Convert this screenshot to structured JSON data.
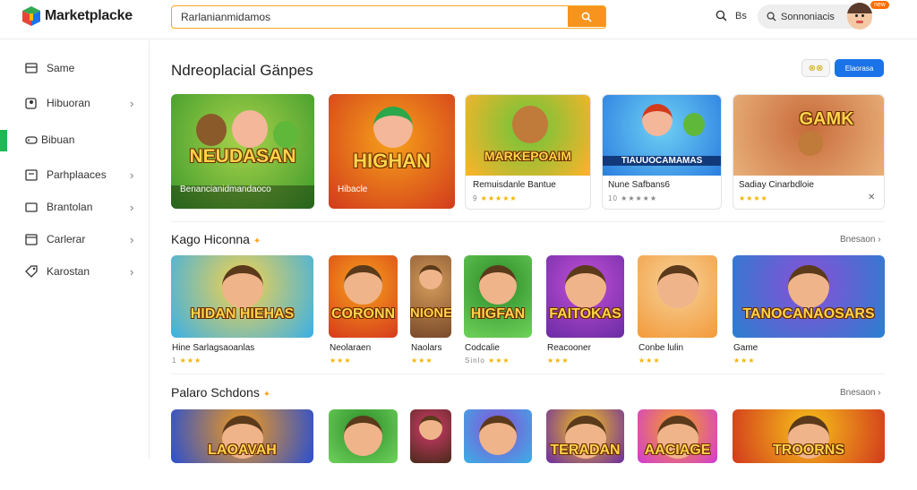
{
  "header": {
    "logo_text": "Marketplacke",
    "search_value": "Rarlanianmidamos",
    "secondary_label": "Bs",
    "user_chip_label": "Sonnoniacis",
    "badge": "new"
  },
  "sidebar": {
    "items": [
      {
        "label": "Same",
        "icon": "window-icon",
        "chevron": false,
        "active": false
      },
      {
        "label": "Hibuoran",
        "icon": "puzzle-icon",
        "chevron": true,
        "active": false
      },
      {
        "label": "Bibuan",
        "icon": "gamepad-icon",
        "chevron": false,
        "active": true
      },
      {
        "label": "Parhplaaces",
        "icon": "store-icon",
        "chevron": true,
        "active": false
      },
      {
        "label": "Brantolan",
        "icon": "card-icon",
        "chevron": true,
        "active": false
      },
      {
        "label": "Carlerar",
        "icon": "calendar-icon",
        "chevron": true,
        "active": false
      },
      {
        "label": "Karostan",
        "icon": "tag-icon",
        "chevron": true,
        "active": false
      }
    ]
  },
  "featured": {
    "title": "Ndreoplacial Gänpes",
    "blue_button": "Elaorasa",
    "yellow_button": "⊗⊗",
    "cards": [
      {
        "art_title": "NEUDASAN",
        "caption": "Benancianidmandaoco",
        "art_color": "#3c9a2b",
        "art_color2": "#a9d24a"
      },
      {
        "art_title": "HIGHAN",
        "caption": "Hibacle",
        "art_color": "#d23a1c",
        "art_color2": "#f6a21a"
      },
      {
        "art_title": "MARKEPOAIM",
        "caption": "Remuisdanle Bantue",
        "rating": "9",
        "art_color": "#ffb22a",
        "art_color2": "#68c63a"
      },
      {
        "art_title": "TIAUUOCAMAMAS",
        "caption": "Nune Safbans6",
        "rating": "10",
        "art_color": "#2b7ee0",
        "art_color2": "#6fd0f3"
      },
      {
        "art_title": "GAMK",
        "caption": "Sadiay Cinarbdloie",
        "rating": "",
        "art_color": "#e8b07a",
        "art_color2": "#c86b3a"
      }
    ]
  },
  "row2": {
    "title": "Kago Hiconna",
    "see_all": "Bnesaon",
    "cards": [
      {
        "art_title": "HIDAN HIEHAS",
        "caption": "Hine Sarlagsaoanlas",
        "rating": "1",
        "art_color": "#3ab0e6",
        "art_color2": "#f7d24b"
      },
      {
        "art_title": "CORONN",
        "caption": "Neolaraen",
        "rating": "",
        "art_color": "#d63a1c",
        "art_color2": "#f6a21a"
      },
      {
        "art_title": "NIONE",
        "caption": "Naolars",
        "rating": "",
        "art_color": "#7a4a2a",
        "art_color2": "#d29a5a"
      },
      {
        "art_title": "HIGFAN",
        "caption": "Codcalie",
        "rating": "Sinlo",
        "art_color": "#6ed35a",
        "art_color2": "#2c8a2a"
      },
      {
        "art_title": "FAITOKAS",
        "caption": "Reacooner",
        "rating": "",
        "art_color": "#6a2ba4",
        "art_color2": "#c24fd6"
      },
      {
        "art_title": "",
        "caption": "Conbe lulin",
        "rating": "",
        "art_color": "#f39a3a",
        "art_color2": "#f6d29a"
      },
      {
        "art_title": "TANOCANAOSARS",
        "caption": "Game",
        "rating": "",
        "art_color": "#2a7fd0",
        "art_color2": "#8a4fd6"
      }
    ]
  },
  "row3": {
    "title": "Palaro Schdons",
    "see_all": "Bnesaon",
    "cards": [
      {
        "art_title": "LAOAVAH",
        "art_color": "#2a4fd0",
        "art_color2": "#f39a1a"
      },
      {
        "art_title": "",
        "art_color": "#6ed35a",
        "art_color2": "#2c8a2a"
      },
      {
        "art_title": "",
        "art_color": "#4a2a1a",
        "art_color2": "#d23a6a"
      },
      {
        "art_title": "",
        "art_color": "#3ab0e6",
        "art_color2": "#8a4fd6"
      },
      {
        "art_title": "TERADAN",
        "art_color": "#6a2ba4",
        "art_color2": "#f6c21a"
      },
      {
        "art_title": "AACIAGE",
        "art_color": "#d23ad6",
        "art_color2": "#f6a21a"
      },
      {
        "art_title": "TROORNS",
        "art_color": "#d23a1c",
        "art_color2": "#f6c21a"
      }
    ]
  }
}
